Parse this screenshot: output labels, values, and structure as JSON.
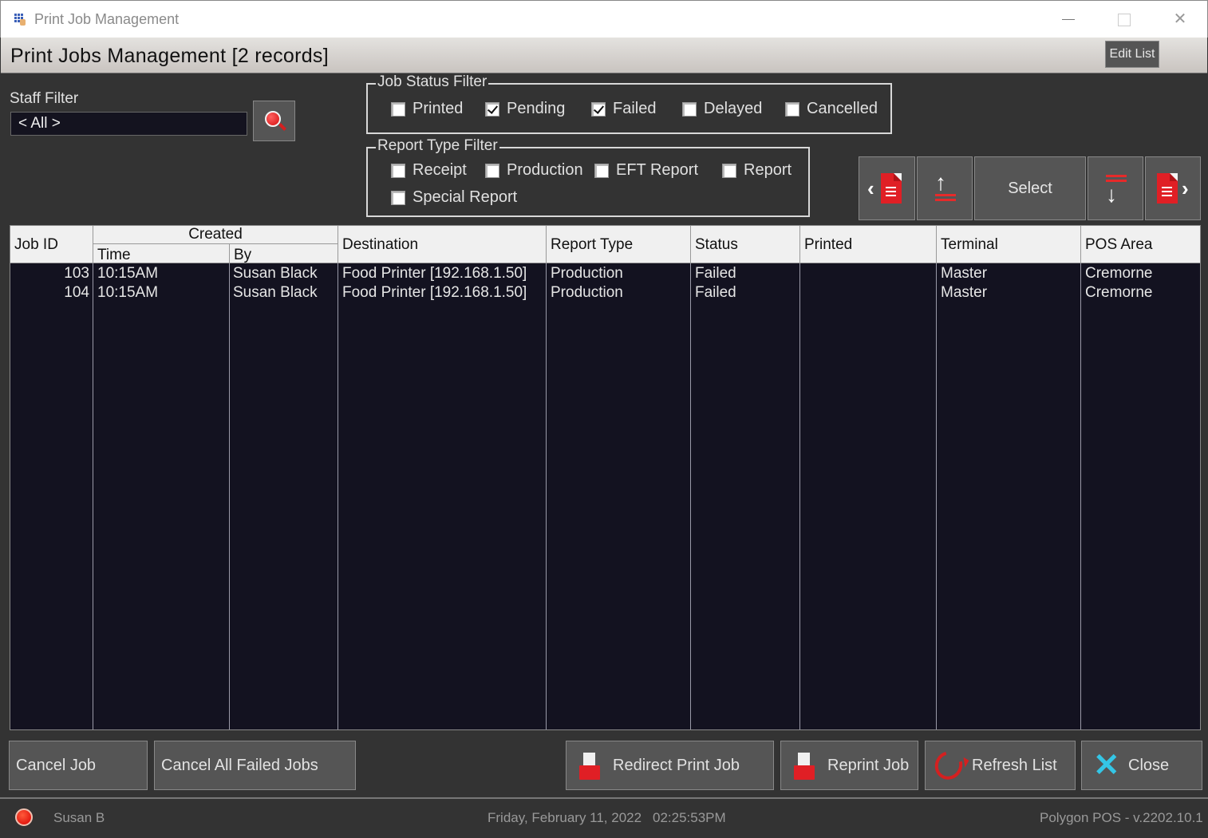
{
  "window": {
    "title": "Print Job Management",
    "controls": {
      "minimize": "minimize",
      "maximize": "maximize",
      "close": "✕"
    }
  },
  "header": {
    "title": "Print Jobs Management [2 records]",
    "edit_list_label": "Edit List"
  },
  "staff_filter": {
    "label": "Staff Filter",
    "value": "< All >"
  },
  "job_status_filter": {
    "title": "Job Status Filter",
    "options": [
      {
        "label": "Printed",
        "checked": false
      },
      {
        "label": "Pending",
        "checked": true
      },
      {
        "label": "Failed",
        "checked": true
      },
      {
        "label": "Delayed",
        "checked": false
      },
      {
        "label": "Cancelled",
        "checked": false
      }
    ]
  },
  "report_type_filter": {
    "title": "Report Type Filter",
    "options": [
      {
        "label": "Receipt",
        "checked": false
      },
      {
        "label": "Production",
        "checked": false
      },
      {
        "label": "EFT Report",
        "checked": false
      },
      {
        "label": "Report",
        "checked": false
      },
      {
        "label": "Special Report",
        "checked": false
      }
    ]
  },
  "navigation": {
    "select_label": "Select"
  },
  "table": {
    "headers": {
      "job_id": "Job ID",
      "created": "Created",
      "time": "Time",
      "by": "By",
      "destination": "Destination",
      "report_type": "Report Type",
      "status": "Status",
      "printed": "Printed",
      "terminal": "Terminal",
      "pos_area": "POS Area"
    },
    "rows": [
      {
        "job_id": "103",
        "time": "10:15AM",
        "by": "Susan Black",
        "destination": "Food Printer [192.168.1.50]",
        "report_type": "Production",
        "status": "Failed",
        "printed": "",
        "terminal": "Master",
        "pos_area": "Cremorne"
      },
      {
        "job_id": "104",
        "time": "10:15AM",
        "by": "Susan Black",
        "destination": "Food Printer [192.168.1.50]",
        "report_type": "Production",
        "status": "Failed",
        "printed": "",
        "terminal": "Master",
        "pos_area": "Cremorne"
      }
    ]
  },
  "buttons": {
    "cancel_job": "Cancel Job",
    "cancel_all_failed": "Cancel All Failed Jobs",
    "redirect_print_job": "Redirect Print Job",
    "reprint_job": "Reprint Job",
    "refresh_list": "Refresh List",
    "close": "Close"
  },
  "status_bar": {
    "user": "Susan B",
    "date": "Friday, February 11, 2022",
    "time": "02:25:53PM",
    "version": "Polygon POS - v.2202.10.1",
    "indicator_color": "#e00000"
  },
  "colors": {
    "accent_red": "#e01f25",
    "close_icon": "#34c6e6",
    "grid_bg": "#131220",
    "panel_bg": "#333333"
  }
}
